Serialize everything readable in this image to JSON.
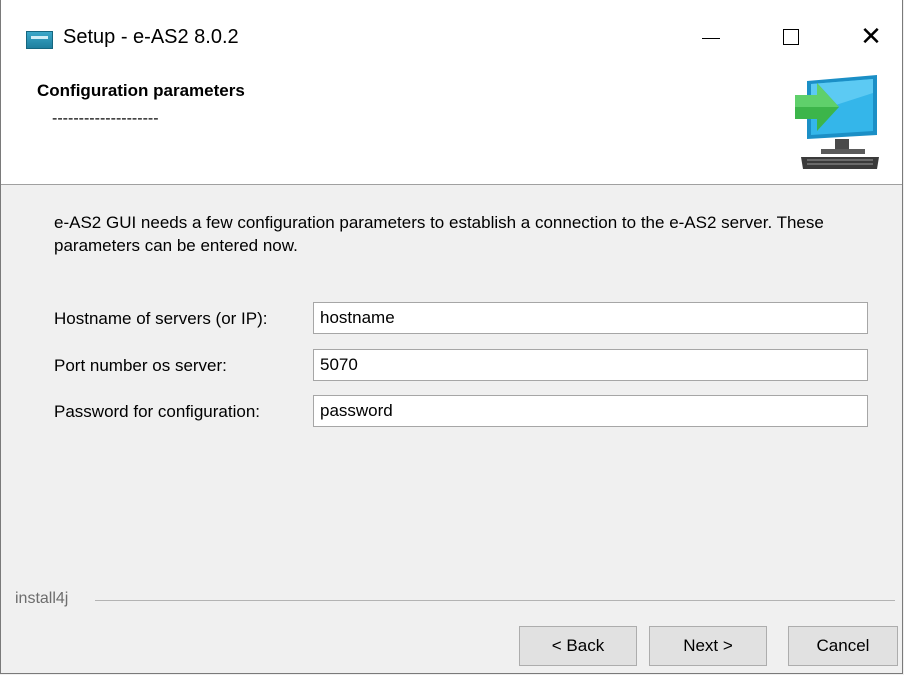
{
  "window": {
    "title": "Setup - e-AS2 8.0.2",
    "controls": {
      "minimize_icon": "minimize-icon",
      "maximize_icon": "maximize-icon",
      "close_icon": "close-icon"
    }
  },
  "header": {
    "title": "Configuration parameters",
    "subtitle": "--------------------",
    "icon": "monitor-arrow-icon"
  },
  "content": {
    "intro": "e-AS2 GUI needs a few configuration parameters to establish a connection to the e-AS2 server. These parameters can be entered now.",
    "fields": [
      {
        "label": "Hostname of servers (or IP):",
        "value": "hostname"
      },
      {
        "label": "Port number os server:",
        "value": "5070"
      },
      {
        "label": "Password for configuration:",
        "value": "password"
      }
    ]
  },
  "footer": {
    "brand": "install4j",
    "back_label": "< Back",
    "next_label": "Next >",
    "cancel_label": "Cancel"
  },
  "colors": {
    "header_bg": "#ffffff",
    "body_bg": "#f0f0f0",
    "button_bg": "#e1e1e1",
    "icon_green": "#3cb54a",
    "icon_screen": "#29a9e1"
  }
}
